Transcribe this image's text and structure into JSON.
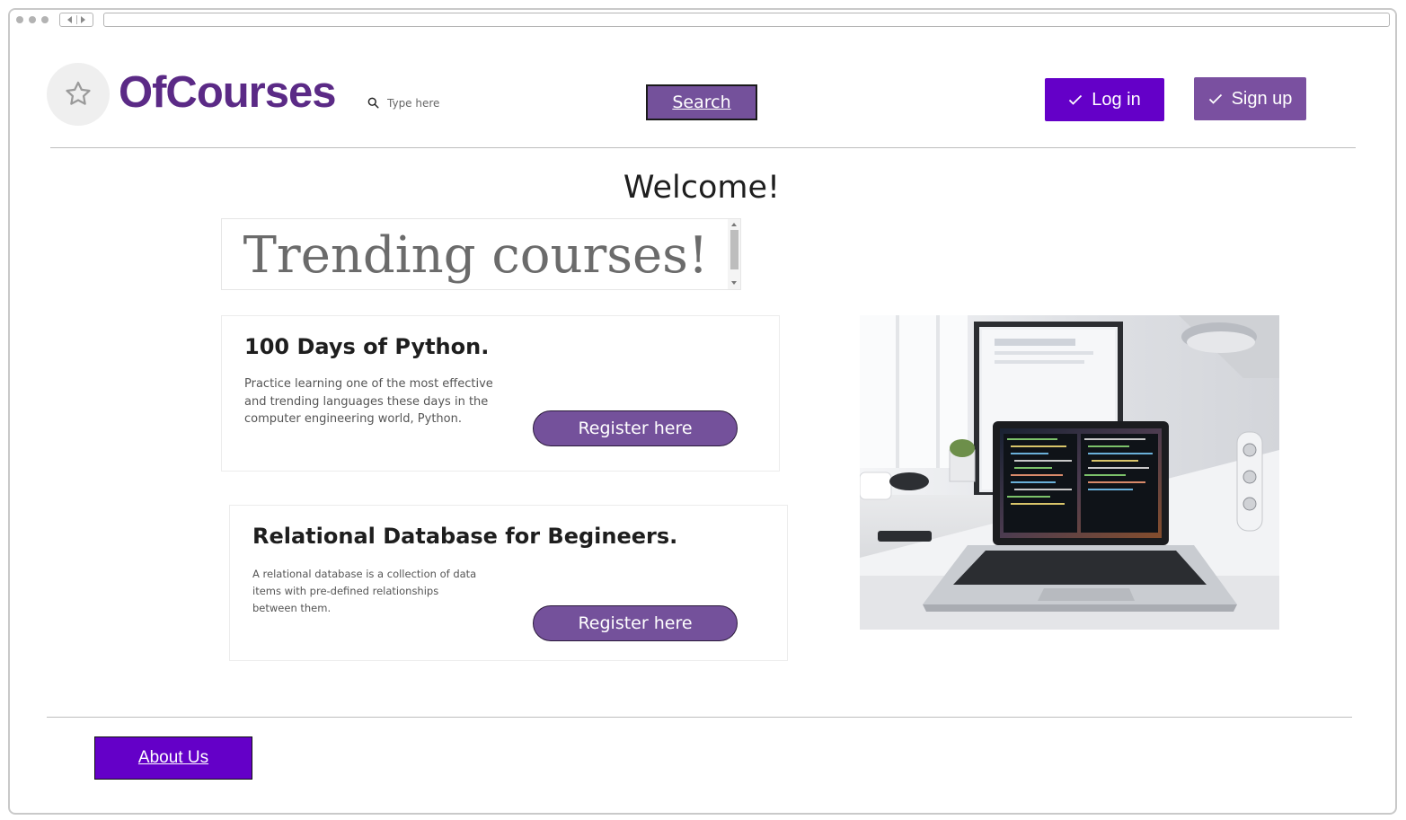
{
  "brand": {
    "name": "OfCourses",
    "logo_icon": "star-icon"
  },
  "search": {
    "placeholder": "Type here",
    "button_label": "Search"
  },
  "auth": {
    "login_label": "Log in",
    "signup_label": "Sign up"
  },
  "main": {
    "welcome": "Welcome!",
    "trending_heading": "Trending courses!",
    "courses": [
      {
        "title": "100 Days of Python.",
        "description": "Practice learning one of the most effective and trending languages these days in the computer engineering world, Python.",
        "button_label": "Register here"
      },
      {
        "title": "Relational Database for Begineers.",
        "description": "A relational database is a collection of data items with pre-defined relationships between them.",
        "button_label": "Register here"
      }
    ],
    "image_subject": "laptop-on-desk-photo"
  },
  "footer": {
    "about_label": "About Us"
  },
  "colors": {
    "brand": "#5b2a86",
    "primary_button": "#6400c8",
    "secondary_button": "#74519b",
    "signup_button": "#7a50a0"
  }
}
